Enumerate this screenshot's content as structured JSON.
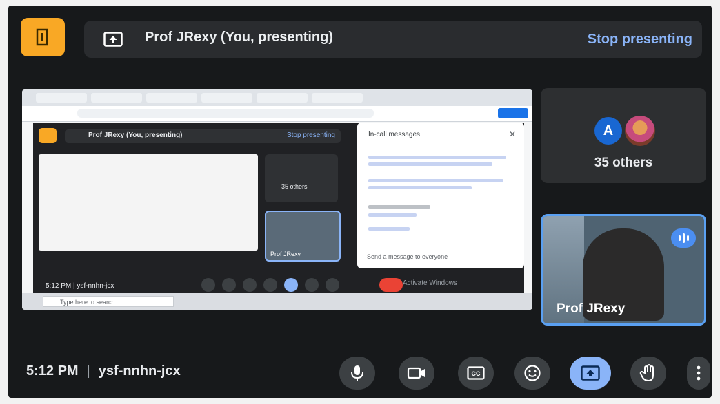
{
  "header": {
    "presenting_label": "Prof JRexy (You, presenting)",
    "stop_presenting": "Stop presenting"
  },
  "shared_screen": {
    "inner_presenting_label": "Prof JRexy (You, presenting)",
    "inner_stop_label": "Stop presenting",
    "inner_others_label": "35 others",
    "inner_self_label": "Prof JRexy",
    "chat_title": "In-call messages",
    "chat_input_placeholder": "Send a message to everyone",
    "inner_time": "5:12 PM",
    "inner_meeting_code": "ysf-nnhn-jcx",
    "activate_text": "Activate Windows",
    "taskbar_search": "Type here to search"
  },
  "tiles": {
    "others_avatar_letter": "A",
    "others_label": "35 others",
    "self_name": "Prof JRexy"
  },
  "footer": {
    "time": "5:12 PM",
    "separator": "|",
    "meeting_code": "ysf-nnhn-jcx"
  },
  "controls": [
    {
      "name": "microphone",
      "icon": "mic-icon",
      "active": false
    },
    {
      "name": "camera",
      "icon": "camera-icon",
      "active": false
    },
    {
      "name": "captions",
      "icon": "captions-icon",
      "active": false
    },
    {
      "name": "reactions",
      "icon": "emoji-icon",
      "active": false
    },
    {
      "name": "present",
      "icon": "present-icon",
      "active": true
    },
    {
      "name": "raise-hand",
      "icon": "hand-icon",
      "active": false
    },
    {
      "name": "more-options",
      "icon": "more-vert-icon",
      "active": false
    }
  ],
  "colors": {
    "accent": "#8ab4f8",
    "exit_tile": "#f9a825",
    "background": "#17191b",
    "present_active": "#8ab4f8",
    "end_call": "#ea4335"
  }
}
